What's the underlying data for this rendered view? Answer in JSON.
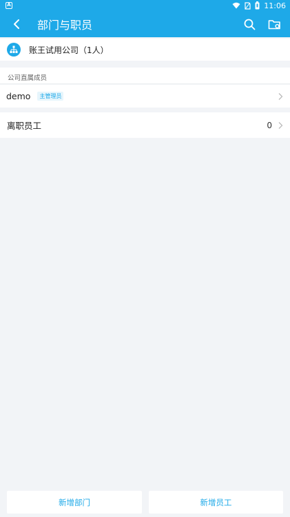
{
  "status_bar": {
    "left_badge": "A",
    "time": "11:06",
    "icons": [
      "wifi-icon",
      "no-sim-icon",
      "battery-icon"
    ]
  },
  "app_bar": {
    "title": "部门与职员",
    "icons": [
      "back-arrow-icon",
      "search-icon",
      "folder-settings-icon"
    ]
  },
  "company": {
    "name": "账王试用公司（1人）",
    "icon": "org-chart-icon"
  },
  "section": {
    "label": "公司直属成员"
  },
  "members": [
    {
      "name": "demo",
      "role": "主管理员"
    }
  ],
  "resigned": {
    "label": "离职员工",
    "count": "0"
  },
  "bottom_actions": {
    "add_department": "新增部门",
    "add_employee": "新增员工"
  },
  "colors": {
    "primary": "#1ea9e8",
    "background": "#f2f4f7",
    "surface": "#ffffff",
    "badge_bg": "#e6f5fc"
  }
}
